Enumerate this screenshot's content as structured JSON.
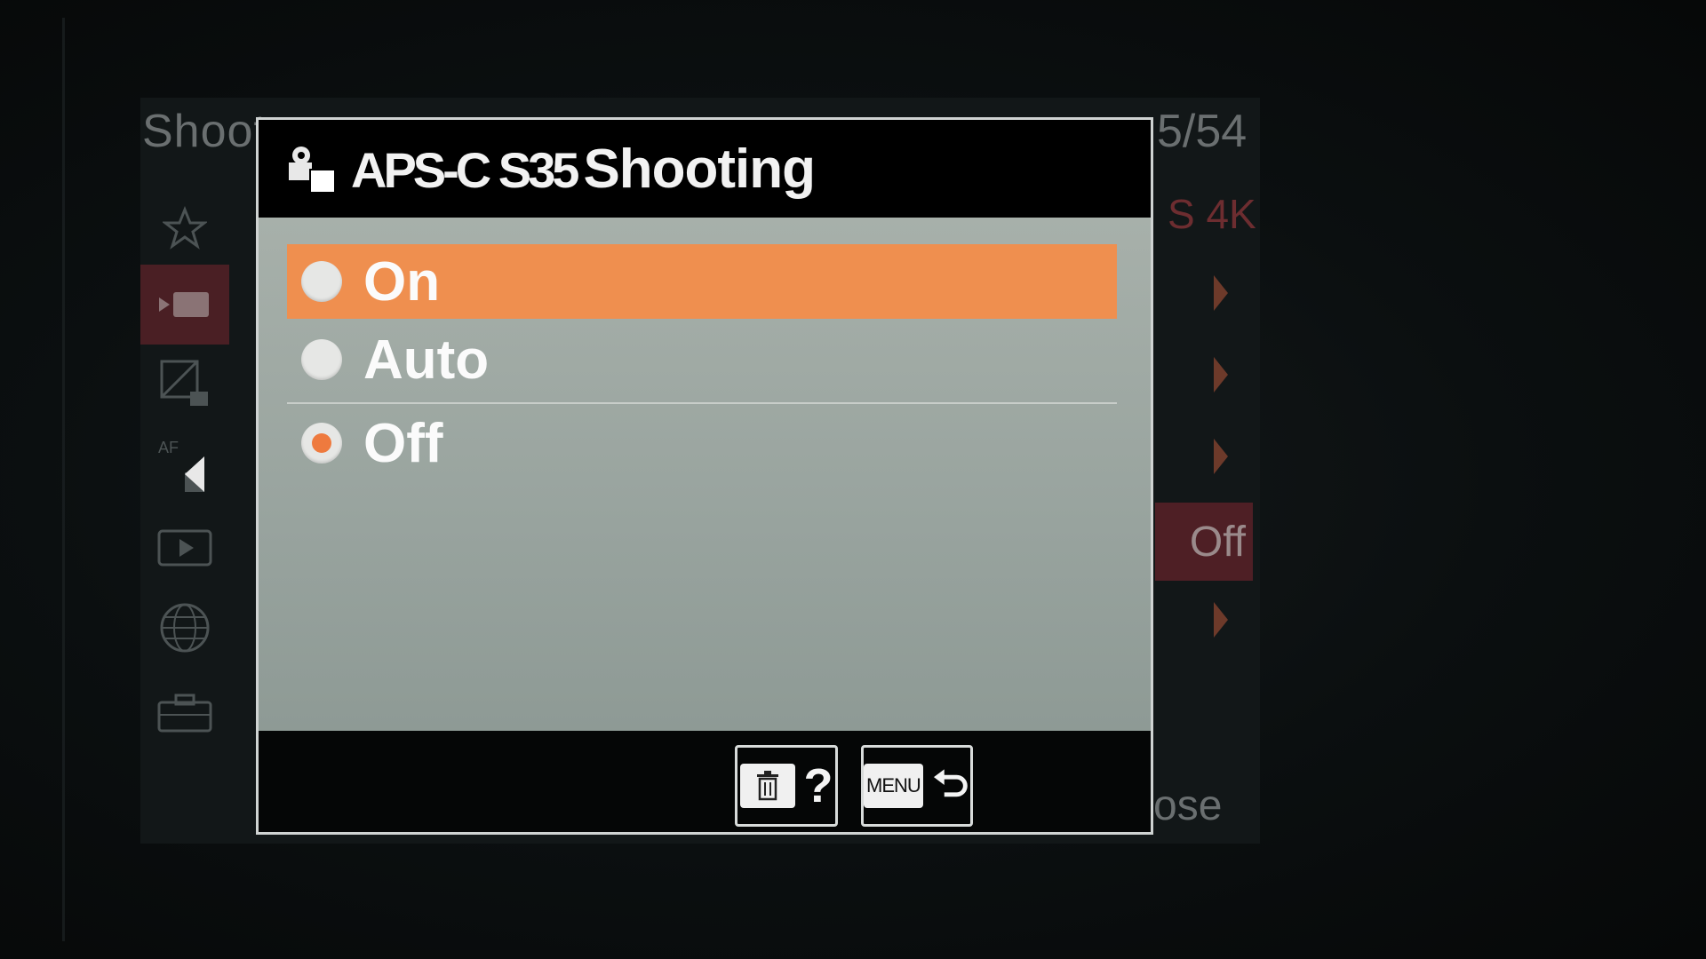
{
  "background_menu": {
    "header_title": "Shoot",
    "page_indicator": "5/54",
    "right_label_top": "S 4K",
    "current_value": "Off",
    "close_label": "ose",
    "side_tabs": [
      {
        "icon": "star-icon"
      },
      {
        "icon": "movie-camera-icon"
      },
      {
        "icon": "exposure-icon"
      },
      {
        "icon": "af-icon",
        "label": "AF"
      },
      {
        "icon": "playback-icon"
      },
      {
        "icon": "globe-icon"
      },
      {
        "icon": "toolbox-icon"
      }
    ]
  },
  "dialog": {
    "title_prefix": "APS-C S35",
    "title": "Shooting",
    "options": [
      {
        "label": "On",
        "state": "highlighted"
      },
      {
        "label": "Auto",
        "state": "normal"
      },
      {
        "label": "Off",
        "state": "selected-value"
      }
    ],
    "footer": {
      "help_button_symbol": "?",
      "menu_button_label": "MENU"
    }
  },
  "colors": {
    "highlight": "#ef8f4f",
    "radio_dot": "#ee7a3e",
    "panel": "#a2aca6"
  }
}
